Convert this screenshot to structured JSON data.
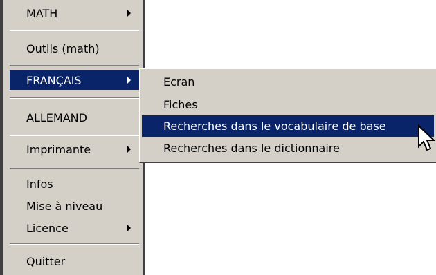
{
  "menu": {
    "items": [
      {
        "label": "MATH",
        "submenu": true
      },
      {
        "label": "Outils (math)",
        "submenu": false
      },
      {
        "label": "FRANÇAIS",
        "submenu": true,
        "selected": true
      },
      {
        "label": "ALLEMAND",
        "submenu": false
      },
      {
        "label": "Imprimante",
        "submenu": true
      },
      {
        "label": "Infos",
        "submenu": false
      },
      {
        "label": "Mise à niveau",
        "submenu": false
      },
      {
        "label": "Licence",
        "submenu": true
      },
      {
        "label": "Quitter",
        "submenu": false
      }
    ]
  },
  "submenu": {
    "items": [
      {
        "label": "Ecran"
      },
      {
        "label": "Fiches"
      },
      {
        "label": "Recherches dans le vocabulaire de base",
        "selected": true
      },
      {
        "label": "Recherches dans le dictionnaire"
      }
    ]
  },
  "colors": {
    "menu_bg": "#d4d0c8",
    "highlight": "#0a246a",
    "highlight_text": "#ffffff"
  },
  "cursor": "arrow-pointer-icon"
}
